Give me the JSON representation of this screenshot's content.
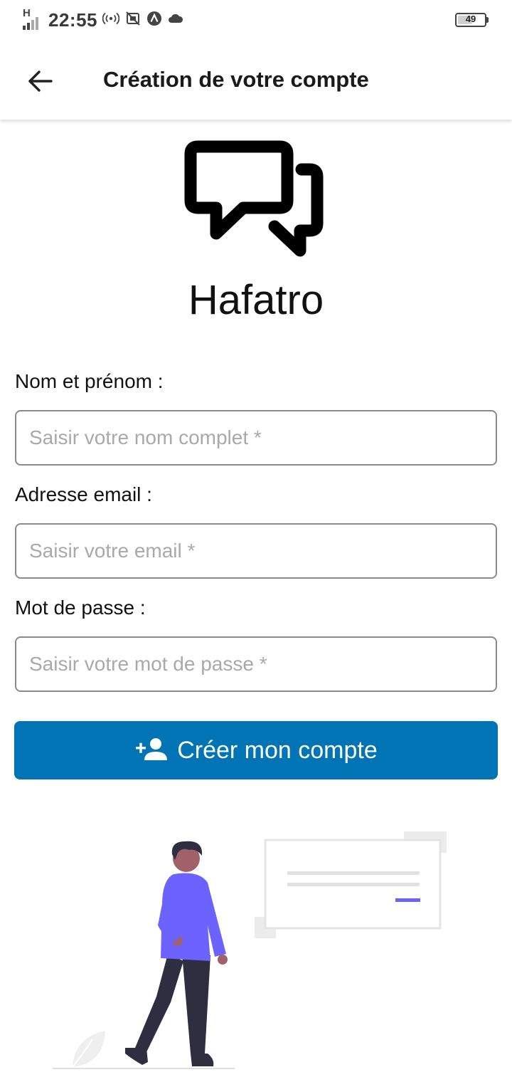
{
  "status_bar": {
    "network_type": "H",
    "time": "22:55",
    "battery_level": "49",
    "battery_fraction": 0.49,
    "icons": [
      "hotspot-icon",
      "screenshot-icon",
      "app-a-icon",
      "cloud-icon"
    ]
  },
  "app_bar": {
    "title": "Création de votre compte",
    "back_icon": "arrow-left-icon"
  },
  "logo": {
    "icon": "chat-bubbles-icon",
    "app_name": "Hafatro"
  },
  "form": {
    "fullname": {
      "label": "Nom et prénom :",
      "placeholder": "Saisir votre nom complet *",
      "value": ""
    },
    "email": {
      "label": "Adresse email :",
      "placeholder": "Saisir votre email *",
      "value": ""
    },
    "password": {
      "label": "Mot de passe :",
      "placeholder": "Saisir votre mot de passe *",
      "value": ""
    },
    "submit": {
      "icon": "person-add-icon",
      "label": "Créer mon compte"
    }
  },
  "colors": {
    "primary": "#0074b5",
    "accent_illustration": "#6c63ff",
    "input_border": "#8a8a8a",
    "placeholder": "#a9a9a9"
  },
  "illustration": {
    "icon": "person-with-message-card-illustration"
  }
}
